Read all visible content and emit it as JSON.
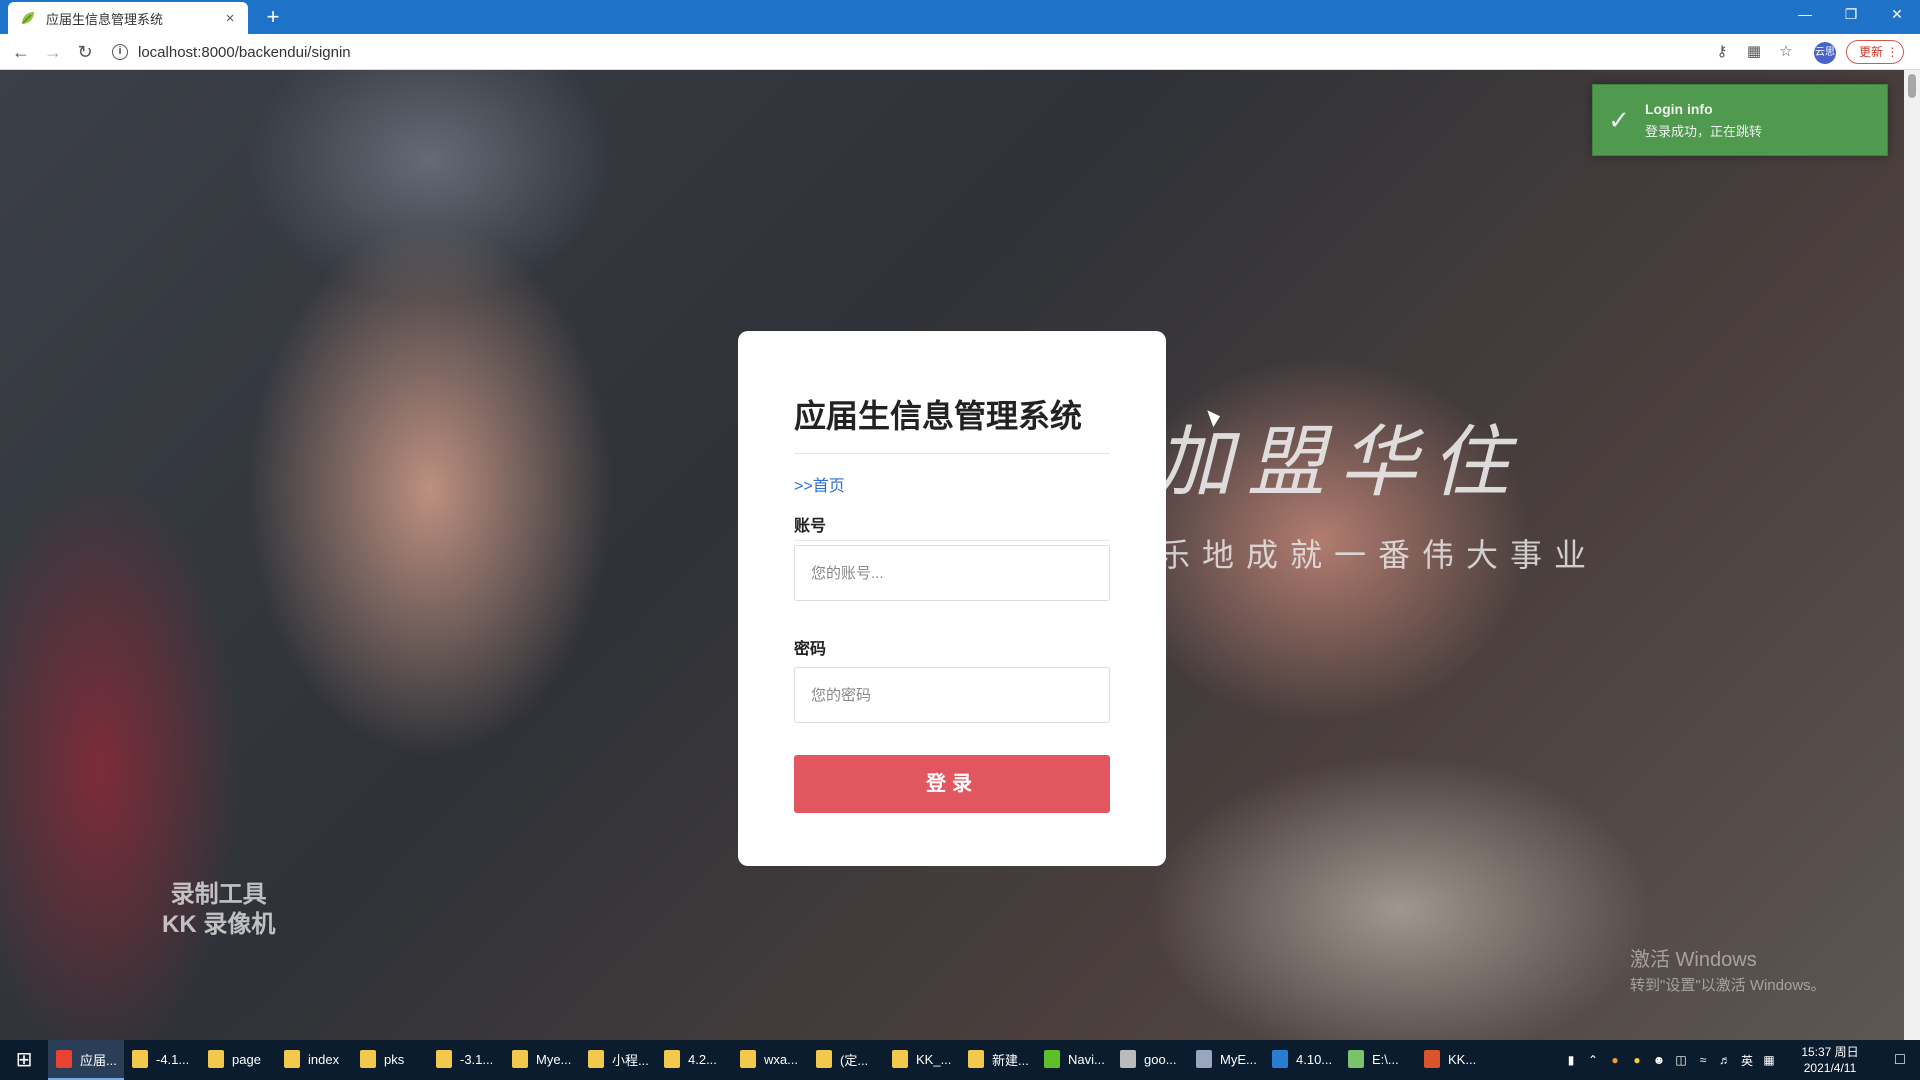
{
  "browser": {
    "tab_title": "应届生信息管理系统",
    "tab_close": "×",
    "new_tab": "+",
    "url": "localhost:8000/backendui/signin",
    "profile_label": "云思",
    "update_label": "更新 ⋮"
  },
  "background": {
    "slogan_line1": "加盟华住",
    "slogan_line2": "乐地成就一番伟大事业",
    "watermark_line1": "录制工具",
    "watermark_line2": "KK 录像机",
    "activate_line1": "激活 Windows",
    "activate_line2": "转到\"设置\"以激活 Windows。"
  },
  "login": {
    "title": "应届生信息管理系统",
    "home_link": ">>首页",
    "account_label": "账号",
    "account_placeholder": "您的账号...",
    "password_label": "密码",
    "password_placeholder": "您的密码",
    "submit_label": "登录"
  },
  "toast": {
    "title": "Login info",
    "message": "登录成功，正在跳转",
    "color": "#51a351"
  },
  "taskbar": {
    "items": [
      {
        "label": "应届...",
        "icon": "chrome-icon",
        "color": "#e94235",
        "active": true
      },
      {
        "label": "-4.1...",
        "icon": "folder-icon",
        "color": "#f3c94d"
      },
      {
        "label": "page",
        "icon": "folder-icon",
        "color": "#f3c94d"
      },
      {
        "label": "index",
        "icon": "folder-icon",
        "color": "#f3c94d"
      },
      {
        "label": "pks",
        "icon": "folder-icon",
        "color": "#f3c94d"
      },
      {
        "label": "-3.1...",
        "icon": "folder-icon",
        "color": "#f3c94d"
      },
      {
        "label": "Mye...",
        "icon": "folder-icon",
        "color": "#f3c94d"
      },
      {
        "label": "小程...",
        "icon": "folder-icon",
        "color": "#f3c94d"
      },
      {
        "label": "4.2...",
        "icon": "folder-icon",
        "color": "#f3c94d"
      },
      {
        "label": "wxa...",
        "icon": "folder-icon",
        "color": "#f3c94d"
      },
      {
        "label": "(定...",
        "icon": "folder-icon",
        "color": "#f3c94d"
      },
      {
        "label": "KK_...",
        "icon": "folder-icon",
        "color": "#f3c94d"
      },
      {
        "label": "新建...",
        "icon": "folder-icon",
        "color": "#f3c94d"
      },
      {
        "label": "Navi...",
        "icon": "navicat-icon",
        "color": "#5cbf2a"
      },
      {
        "label": "goo...",
        "icon": "drive-icon",
        "color": "#bbbbbb"
      },
      {
        "label": "MyE...",
        "icon": "myeclipse-icon",
        "color": "#9aa6c0"
      },
      {
        "label": "4.10...",
        "icon": "vscode-icon",
        "color": "#2a7cd0"
      },
      {
        "label": "E:\\...",
        "icon": "notepad-icon",
        "color": "#7ac36a"
      },
      {
        "label": "KK...",
        "icon": "kk-recorder-icon",
        "color": "#d9532c"
      }
    ],
    "tray_ime": "英",
    "clock_time": "15:37 周日",
    "clock_date": "2021/4/11"
  }
}
